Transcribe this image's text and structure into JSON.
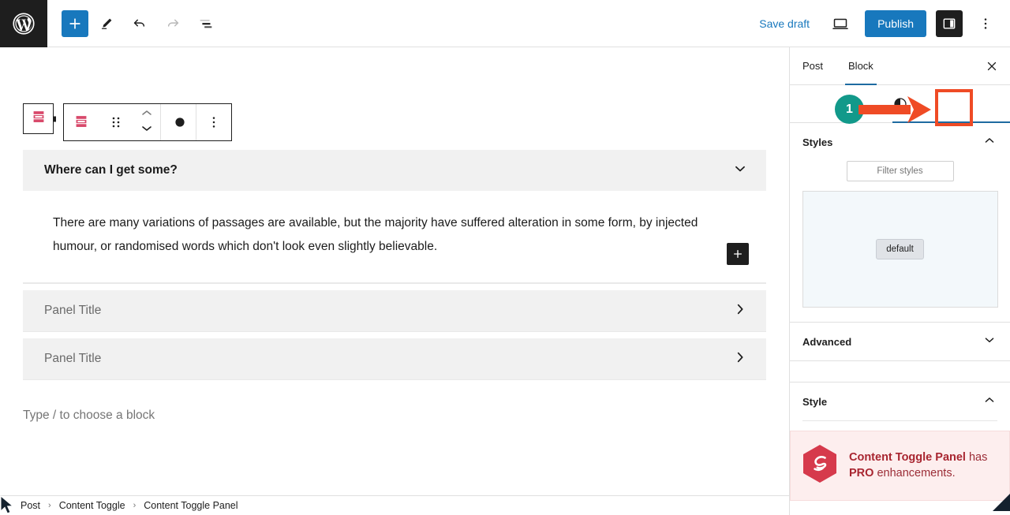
{
  "topbar": {
    "logo_icon": "wordpress-logo-icon",
    "add_block_icon": "plus-icon",
    "edit_tool_icon": "pencil-icon",
    "undo_icon": "undo-arrow-icon",
    "redo_icon": "redo-arrow-icon",
    "list_view_icon": "document-overview-icon",
    "save_draft_label": "Save draft",
    "preview_icon": "desktop-preview-icon",
    "publish_label": "Publish",
    "settings_panel_icon": "sidebar-toggle-icon",
    "options_icon": "vertical-ellipsis-icon",
    "accent_blue": "#1878bd",
    "dark": "#1e1e1e"
  },
  "block_toolbar": {
    "parent_block_icon": "content-toggle-parent-icon",
    "block_icon": "content-toggle-panel-icon",
    "drag_handle_icon": "drag-dots-icon",
    "move_up_icon": "chevron-up-icon",
    "move_down_icon": "chevron-down-icon",
    "styles_icon": "shadow-styles-icon",
    "more_options_icon": "vertical-ellipsis-icon"
  },
  "editor": {
    "panels": [
      {
        "title": "Where can I get some?",
        "expanded": true,
        "chevron_icon": "chevron-down-icon",
        "body": "There are many variations of passages are available, but the majority have suffered alteration in some form, by injected humour, or randomised words which don't look even slightly believable.",
        "inline_add_icon": "plus-icon"
      },
      {
        "title": "Panel Title",
        "expanded": false,
        "chevron_icon": "chevron-right-icon"
      },
      {
        "title": "Panel Title",
        "expanded": false,
        "chevron_icon": "chevron-right-icon"
      }
    ],
    "empty_block_placeholder": "Type / to choose a block"
  },
  "breadcrumb": {
    "items": [
      "Post",
      "Content Toggle",
      "Content Toggle Panel"
    ],
    "separator": "›"
  },
  "sidebar": {
    "tabs": [
      {
        "label": "Post",
        "active": false
      },
      {
        "label": "Block",
        "active": true
      }
    ],
    "close_icon": "close-icon",
    "icon_row": {
      "styles_tab_icon": "contrast-half-circle-icon"
    },
    "sections": [
      {
        "label": "Styles",
        "expanded": true,
        "chevron_icon": "chevron-up-icon"
      },
      {
        "label": "Advanced",
        "expanded": false,
        "chevron_icon": "chevron-down-icon"
      },
      {
        "label": "Style",
        "expanded": true,
        "chevron_icon": "chevron-up-icon"
      }
    ],
    "styles": {
      "filter_placeholder": "Filter styles",
      "selected_style": "default",
      "preview_bg": "#f3f8fb"
    },
    "pro_notice": {
      "logo_icon": "content-toggle-hex-logo-icon",
      "bold_product": "Content Toggle Panel",
      "middle_text": " has ",
      "bold_pro": "PRO",
      "tail_text": " enhancements.",
      "bg": "#fdeeee",
      "text_color": "#9b2c36"
    }
  },
  "annotation": {
    "step_number": "1",
    "circle_color": "#12998a",
    "arrow_color": "#ef4b25",
    "highlight_box_color": "#ef4b25",
    "cursor_icon": "mouse-pointer-icon"
  }
}
